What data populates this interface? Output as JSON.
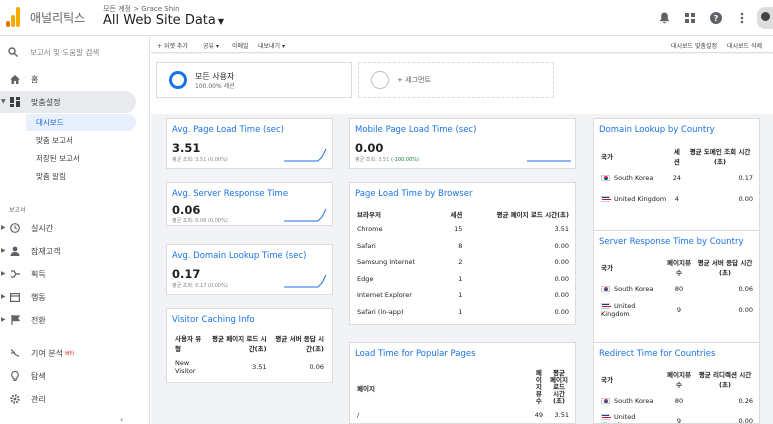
{
  "header": {
    "app_name": "애널리틱스",
    "breadcrumb": "모든 계정 > Grace Shin",
    "view_title": "All Web Site Data",
    "icons": [
      "bell-icon",
      "apps-grid-icon",
      "help-icon",
      "more-vert-icon"
    ]
  },
  "colors": {
    "logo": [
      "#f9ab00",
      "#e37400",
      "#e37400"
    ],
    "accent": "#1a73e8",
    "segment_ring": "#1a73e8"
  },
  "sidebar": {
    "search_placeholder": "보고서 및 도움말 검색",
    "home": "홈",
    "customization": "맞춤설정",
    "sub_items": [
      "대시보드",
      "맞춤 보고서",
      "저장된 보고서",
      "맞춤 알림"
    ],
    "reports_label": "보고서",
    "reports": [
      "실시간",
      "잠재고객",
      "획득",
      "행동",
      "전환"
    ],
    "attribution": "기여 분석",
    "attribution_badge": "베타",
    "discover": "탐색",
    "admin": "관리"
  },
  "toolbar": {
    "add_widget": "+ 위젯 추가",
    "share": "공유",
    "email": "이메일",
    "export": "내보내기",
    "customize_dashboard": "대시보드 맞춤설정",
    "delete_dashboard": "대시보드 삭제"
  },
  "segments": {
    "all_users_title": "모든 사용자",
    "all_users_sub": "100.00% 세션",
    "add_segment": "+ 세그먼트"
  },
  "widgets": {
    "avg_page_load": {
      "title": "Avg. Page Load Time (sec)",
      "value": "3.51",
      "compare_label": "평균 조회:",
      "compare_value": "3.51 (0.00%)"
    },
    "avg_server_response": {
      "title": "Avg. Server Response Time",
      "value": "0.06",
      "compare_label": "평균 조회:",
      "compare_value": "0.06 (0.00%)"
    },
    "avg_domain_lookup": {
      "title": "Avg. Domain Lookup Time (sec)",
      "value": "0.17",
      "compare_label": "평균 조회:",
      "compare_value": "0.17 (0.00%)"
    },
    "mobile_page_load": {
      "title": "Mobile Page Load Time (sec)",
      "value": "0.00",
      "compare_label": "평균 조회:",
      "compare_value": "3.51",
      "compare_change": "(-100.00%)"
    },
    "visitor_caching": {
      "title": "Visitor Caching Info",
      "headers": [
        "사용자 유형",
        "평균 페이지 로드 시간(초)",
        "평균 서버 응답 시간(초)"
      ],
      "rows": [
        [
          "New Visitor",
          "3.51",
          "0.06"
        ]
      ]
    },
    "page_load_by_browser": {
      "title": "Page Load Time by Browser",
      "headers": [
        "브라우저",
        "세션",
        "평균 페이지 로드 시간(초)"
      ],
      "rows": [
        [
          "Chrome",
          "15",
          "3.51"
        ],
        [
          "Safari",
          "8",
          "0.00"
        ],
        [
          "Samsung Internet",
          "2",
          "0.00"
        ],
        [
          "Edge",
          "1",
          "0.00"
        ],
        [
          "Internet Explorer",
          "1",
          "0.00"
        ],
        [
          "Safari (in-app)",
          "1",
          "0.00"
        ]
      ]
    },
    "popular_pages": {
      "title": "Load Time for Popular Pages",
      "headers": [
        "페이지",
        "페이지뷰수",
        "평균 페이지 로드 시간(초)"
      ],
      "rows": [
        [
          "/",
          "49",
          "3.51"
        ]
      ]
    },
    "domain_lookup_by_country": {
      "title": "Domain Lookup by Country",
      "headers": [
        "국가",
        "세션",
        "평균 도메인 조회 시간(초)"
      ],
      "rows": [
        [
          "South Korea",
          "24",
          "0.17"
        ],
        [
          "United Kingdom",
          "4",
          "0.00"
        ]
      ]
    },
    "server_response_by_country": {
      "title": "Server Response Time by Country",
      "headers": [
        "국가",
        "페이지뷰수",
        "평균 서버 응답 시간(초)"
      ],
      "rows": [
        [
          "South Korea",
          "80",
          "0.06"
        ],
        [
          "United Kingdom",
          "9",
          "0.00"
        ]
      ]
    },
    "redirect_time_by_country": {
      "title": "Redirect Time for Countries",
      "headers": [
        "국가",
        "페이지뷰수",
        "평균 리디렉션 시간(초)"
      ],
      "rows": [
        [
          "South Korea",
          "80",
          "0.26"
        ],
        [
          "United Kingdom",
          "9",
          "0.00"
        ]
      ]
    }
  }
}
